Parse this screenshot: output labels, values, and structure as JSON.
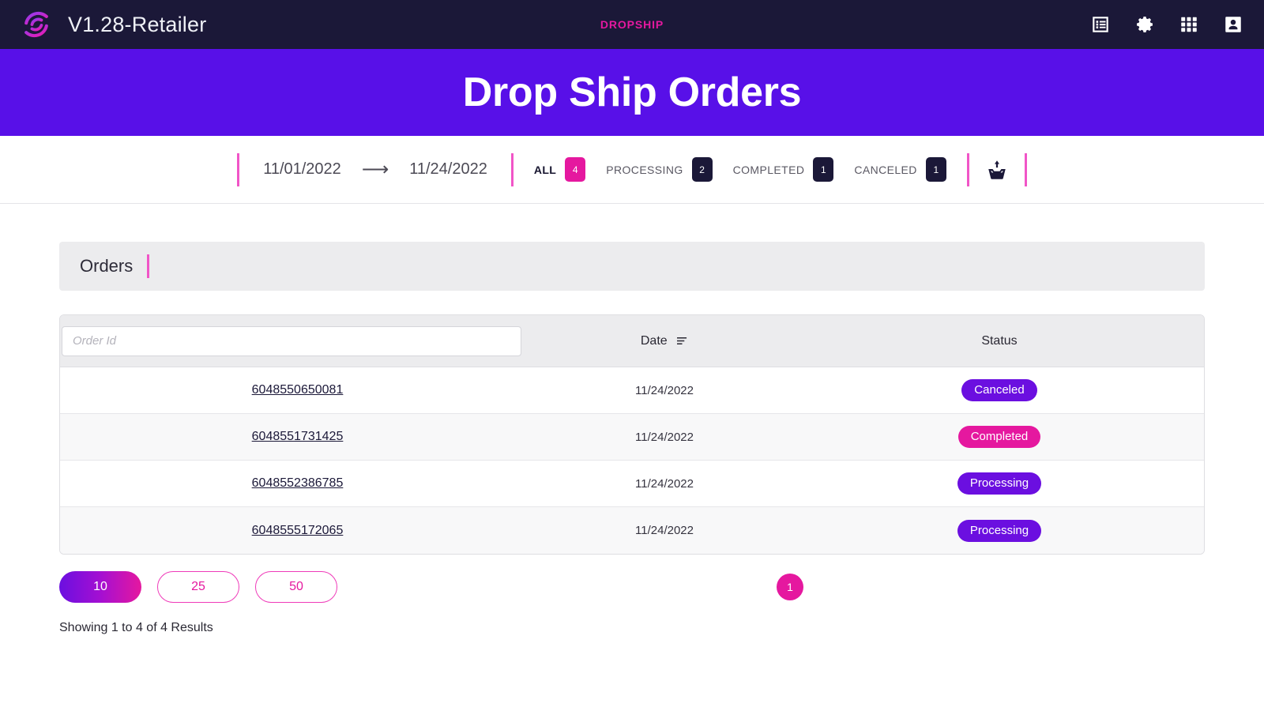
{
  "topbar": {
    "logo_icon": "swirl-logo-icon",
    "brand_title": "V1.28-Retailer",
    "center_label": "DROPSHIP",
    "icons": [
      {
        "name": "list-view-icon",
        "label": "List"
      },
      {
        "name": "gear-icon",
        "label": "Settings"
      },
      {
        "name": "apps-grid-icon",
        "label": "Apps"
      },
      {
        "name": "user-account-icon",
        "label": "Account"
      }
    ],
    "background_color": "#1b1838",
    "accent_color": "#e5189f"
  },
  "banner": {
    "title": "Drop Ship Orders",
    "background_color": "#5810e8"
  },
  "toolbar": {
    "date_from": "11/01/2022",
    "date_arrow": "⟶",
    "date_to": "11/24/2022",
    "tabs": [
      {
        "label": "ALL",
        "count": "4",
        "active": true
      },
      {
        "label": "PROCESSING",
        "count": "2",
        "active": false
      },
      {
        "label": "COMPLETED",
        "count": "1",
        "active": false
      },
      {
        "label": "CANCELED",
        "count": "1",
        "active": false
      }
    ],
    "download_icon": "download-inbox-icon",
    "divider_color": "#f155c7"
  },
  "orders_panel": {
    "title": "Orders"
  },
  "table": {
    "search": {
      "placeholder": "Order Id",
      "value": ""
    },
    "columns": [
      {
        "key": "order_id",
        "label": ""
      },
      {
        "key": "date",
        "label": "Date",
        "sort_icon": "sort-descending-icon"
      },
      {
        "key": "status",
        "label": "Status"
      }
    ],
    "rows": [
      {
        "order_id": "6048550650081",
        "date": "11/24/2022",
        "status": "Canceled",
        "status_color": "#6b0fe0"
      },
      {
        "order_id": "6048551731425",
        "date": "11/24/2022",
        "status": "Completed",
        "status_color": "#e5189f"
      },
      {
        "order_id": "6048552386785",
        "date": "11/24/2022",
        "status": "Processing",
        "status_color": "#6b0fe0"
      },
      {
        "order_id": "6048555172065",
        "date": "11/24/2022",
        "status": "Processing",
        "status_color": "#6b0fe0"
      }
    ]
  },
  "pagination": {
    "page_sizes": [
      {
        "label": "10",
        "active": true
      },
      {
        "label": "25",
        "active": false
      },
      {
        "label": "50",
        "active": false
      }
    ],
    "pages": [
      {
        "label": "1",
        "active": true
      }
    ],
    "showing_text": "Showing 1 to 4 of 4 Results"
  }
}
